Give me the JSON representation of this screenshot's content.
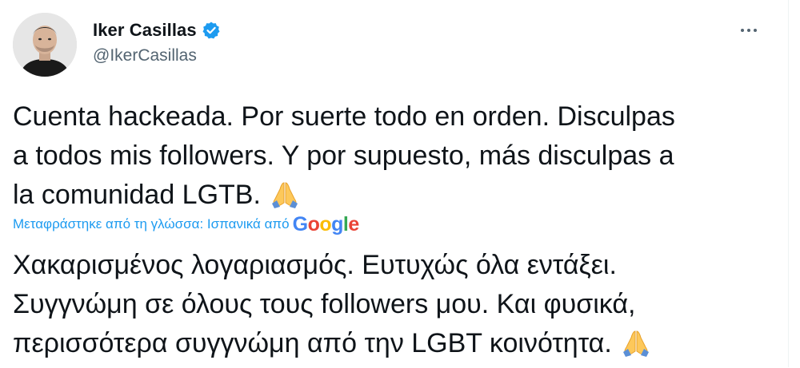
{
  "user": {
    "display_name": "Iker Casillas",
    "handle": "@IkerCasillas",
    "verified": true,
    "verified_color": "#1d9bf0"
  },
  "more_icon": "more-horizontal-icon",
  "tweet": {
    "lines": [
      "Cuenta hackeada. Por suerte todo en orden. Disculpas",
      "a todos mis followers. Y por supuesto, más disculpas a",
      "la comunidad LGTB."
    ],
    "emoji": "folded-hands-emoji"
  },
  "translation": {
    "label": "Μεταφράστηκε από τη γλώσσα: Ισπανικά από",
    "provider": "Google",
    "label_color": "#1d9bf0",
    "lines": [
      "Χακαρισμένος λογαριασμός. Ευτυχώς όλα εντάξει.",
      "Συγγνώμη σε όλους τους followers μου. Και φυσικά,",
      "περισσότερα συγγνώμη από την LGBT κοινότητα."
    ],
    "emoji": "folded-hands-emoji"
  },
  "colors": {
    "text": "#0f1419",
    "secondary": "#536471",
    "link": "#1d9bf0"
  }
}
